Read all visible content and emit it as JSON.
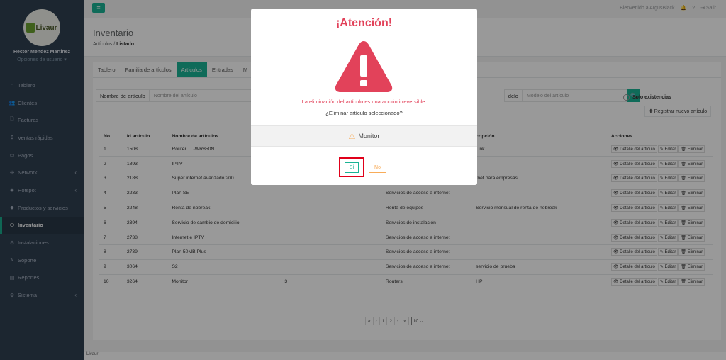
{
  "sidebar": {
    "logo_text": "Livaur",
    "user_name": "Hector Mendez Martinez",
    "user_options": "Opciones de usuario ▾",
    "items": [
      {
        "icon": "⌂",
        "label": "Tablero",
        "arrow": ""
      },
      {
        "icon": "👥",
        "label": "Clientes",
        "arrow": ""
      },
      {
        "icon": "🗋",
        "label": "Facturas",
        "arrow": ""
      },
      {
        "icon": "$",
        "label": "Ventas rápidas",
        "arrow": ""
      },
      {
        "icon": "▭",
        "label": "Pagos",
        "arrow": ""
      },
      {
        "icon": "✣",
        "label": "Network",
        "arrow": "‹"
      },
      {
        "icon": "◈",
        "label": "Hotspot",
        "arrow": "‹"
      },
      {
        "icon": "◆",
        "label": "Productos y servicios",
        "arrow": ""
      },
      {
        "icon": "⚇",
        "label": "Inventario",
        "arrow": ""
      },
      {
        "icon": "⚙",
        "label": "Instalaciones",
        "arrow": ""
      },
      {
        "icon": "✎",
        "label": "Soporte",
        "arrow": ""
      },
      {
        "icon": "▤",
        "label": "Reportes",
        "arrow": ""
      },
      {
        "icon": "⚙",
        "label": "Sistema",
        "arrow": "‹"
      }
    ]
  },
  "topbar": {
    "menu_icon": "≡",
    "welcome": "Bienvenido a ArgusBlack",
    "bell": "🔔",
    "help": "?",
    "logout": "Salir"
  },
  "header": {
    "title": "Inventario",
    "breadcrumb_first": "Artículos",
    "breadcrumb_sep": "/",
    "breadcrumb_current": "Listado"
  },
  "tabs": [
    "Tablero",
    "Familia de artículos",
    "Artículos",
    "Entradas",
    "M"
  ],
  "search": {
    "name_label": "Nombre de artículo",
    "name_placeholder": "Nombre del artículo",
    "model_label": "delo",
    "model_placeholder": "Modelo del artículo",
    "search_icon": "🔍",
    "only_stock": "Solo existencias",
    "new_button": "✚ Registrar nuevo artículo"
  },
  "table": {
    "headers": [
      "No.",
      "Id artículo",
      "Nombre de artículos",
      "",
      "",
      "cripción",
      "Acciones"
    ],
    "rows": [
      [
        "1",
        "1508",
        "Router TL-WR850N",
        "",
        "",
        "Link"
      ],
      [
        "2",
        "1893",
        "IPTV",
        "",
        "",
        ""
      ],
      [
        "3",
        "2188",
        "Super internet avanzado 200",
        "",
        "",
        "rnet para empresas"
      ],
      [
        "4",
        "2233",
        "Plan S5",
        "",
        "Servicios de acceso a internet",
        ""
      ],
      [
        "5",
        "2248",
        "Renta de nobreak",
        "",
        "Renta de equipos",
        "Servicio mensual de renta de nobreak"
      ],
      [
        "6",
        "2394",
        "Servicio de cambio de domicilio",
        "",
        "Servicios de instalación",
        ""
      ],
      [
        "7",
        "2738",
        "Internet e IPTV",
        "",
        "Servicios de acceso a internet",
        ""
      ],
      [
        "8",
        "2739",
        "Plan 50MB Plus",
        "",
        "Servicios de acceso a internet",
        ""
      ],
      [
        "9",
        "3064",
        "S2",
        "",
        "Servicios de acceso a internet",
        "servicio de prueba"
      ],
      [
        "10",
        "3264",
        "Monitor",
        "3",
        "Routers",
        "HP"
      ]
    ],
    "action_detail": "👁 Detalle del artículo",
    "action_edit": "✎ Editar",
    "action_delete": "🗑 Eliminar"
  },
  "pager": {
    "items": [
      "«",
      "‹",
      "1",
      "2",
      "›",
      "»"
    ],
    "page_size": "10 ⌄"
  },
  "footer": "Livaur",
  "modal": {
    "title": "¡Atención!",
    "message": "La eliminación del artículo es una acción irreversible.",
    "question": "¿Eliminar artículo seleccionado?",
    "item_icon": "⚠",
    "item_name": "Monitor",
    "yes_label": "Sí",
    "no_label": "No",
    "colors": {
      "danger": "#e2425a",
      "warning": "#f8ac59",
      "primary": "#1ab394"
    }
  }
}
